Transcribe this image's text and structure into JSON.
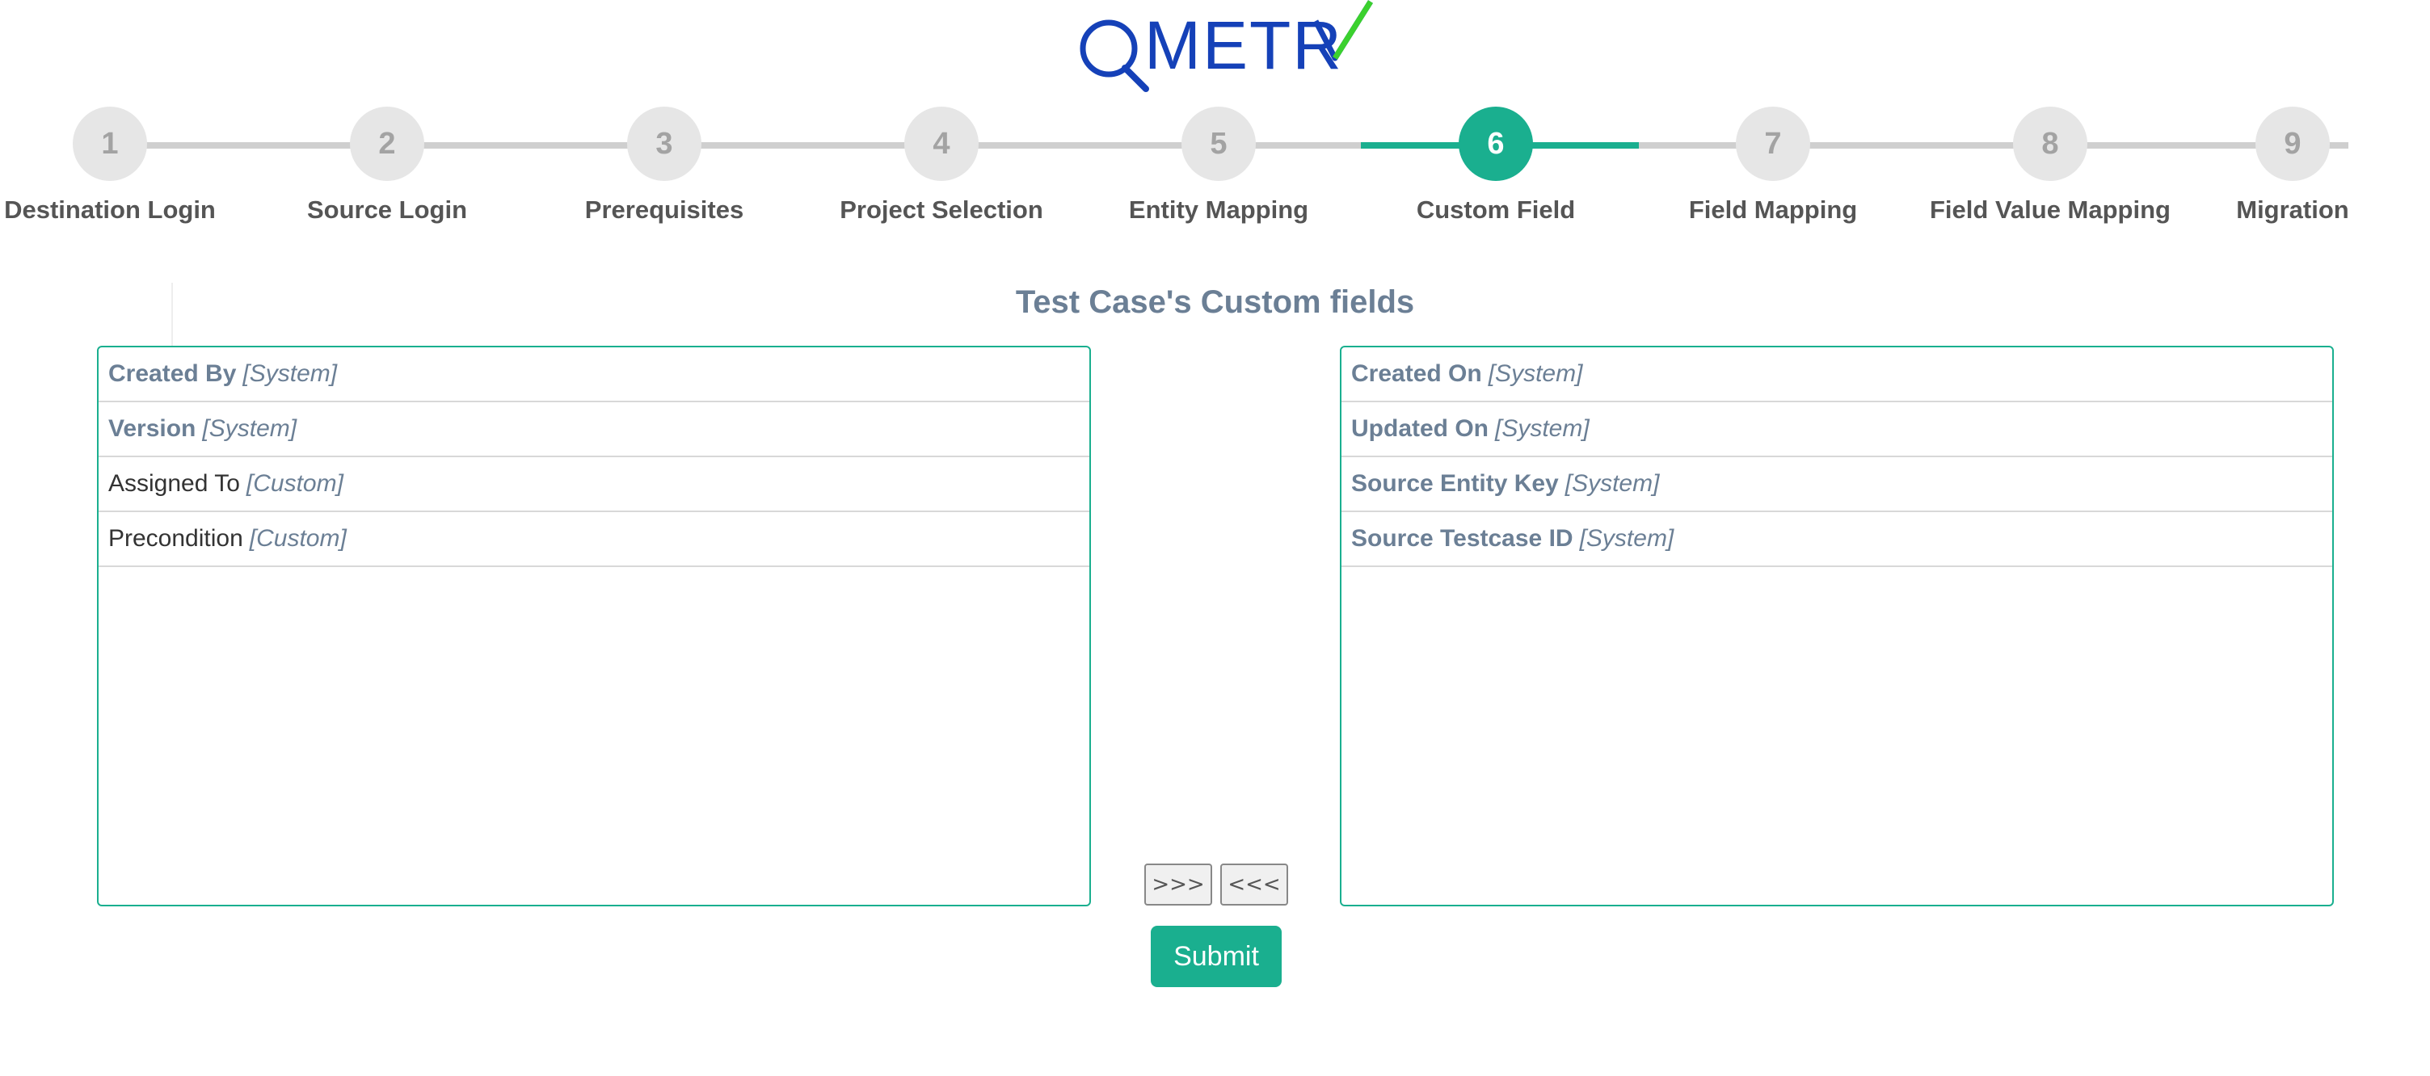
{
  "logo": {
    "text": "METR",
    "colors": {
      "blue": "#1541b8",
      "green": "#3bd12e"
    }
  },
  "stepper": {
    "active_step": 6,
    "accent_color": "#1aaf8f",
    "steps": [
      {
        "number": "1",
        "label": "Destination Login"
      },
      {
        "number": "2",
        "label": "Source Login"
      },
      {
        "number": "3",
        "label": "Prerequisites"
      },
      {
        "number": "4",
        "label": "Project Selection"
      },
      {
        "number": "5",
        "label": "Entity Mapping"
      },
      {
        "number": "6",
        "label": "Custom Field"
      },
      {
        "number": "7",
        "label": "Field Mapping"
      },
      {
        "number": "8",
        "label": "Field Value Mapping"
      },
      {
        "number": "9",
        "label": "Migration"
      }
    ]
  },
  "section": {
    "title": "Test Case's Custom fields"
  },
  "left_list": {
    "items": [
      {
        "name": "Created By",
        "type": "[System]",
        "system": true
      },
      {
        "name": "Version",
        "type": "[System]",
        "system": true
      },
      {
        "name": "Assigned To",
        "type": "[Custom]",
        "system": false
      },
      {
        "name": "Precondition",
        "type": "[Custom]",
        "system": false
      }
    ]
  },
  "right_list": {
    "items": [
      {
        "name": "Created On",
        "type": "[System]",
        "system": true
      },
      {
        "name": "Updated On",
        "type": "[System]",
        "system": true
      },
      {
        "name": "Source Entity Key",
        "type": "[System]",
        "system": true
      },
      {
        "name": "Source Testcase ID",
        "type": "[System]",
        "system": true
      }
    ]
  },
  "actions": {
    "move_right_label": ">>>",
    "move_left_label": "<<<",
    "submit_label": "Submit"
  }
}
